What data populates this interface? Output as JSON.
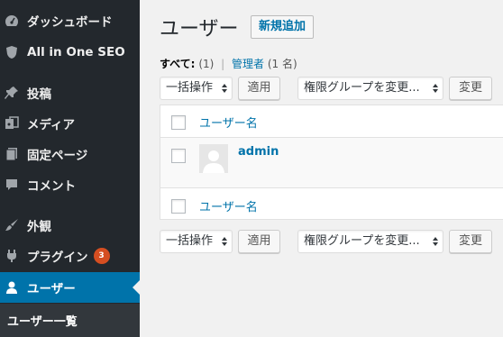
{
  "sidebar": {
    "items": [
      {
        "label": "ダッシュボード",
        "icon": "dashboard-icon"
      },
      {
        "label": "All in One SEO",
        "icon": "shield-icon"
      },
      {
        "label": "投稿",
        "icon": "pin-icon"
      },
      {
        "label": "メディア",
        "icon": "media-icon"
      },
      {
        "label": "固定ページ",
        "icon": "page-icon"
      },
      {
        "label": "コメント",
        "icon": "comment-icon"
      },
      {
        "label": "外観",
        "icon": "brush-icon"
      },
      {
        "label": "プラグイン",
        "icon": "plugin-icon",
        "badge": "3"
      },
      {
        "label": "ユーザー",
        "icon": "user-icon",
        "active": true
      }
    ],
    "submenu": {
      "label": "ユーザー一覧"
    },
    "colors": {
      "bg": "#23282d",
      "active": "#0073aa",
      "badge": "#d54e21"
    }
  },
  "header": {
    "title": "ユーザー",
    "add_new": "新規追加"
  },
  "filters": {
    "all_label": "すべて:",
    "all_count": "(1)",
    "separator": "|",
    "admin_label": "管理者",
    "admin_count": "(1 名)"
  },
  "bulk_top": {
    "action_select": "一括操作",
    "apply": "適用",
    "role_select": "権限グループを変更...",
    "change": "変更"
  },
  "table": {
    "header_col": "ユーザー名",
    "footer_col": "ユーザー名",
    "rows": [
      {
        "username": "admin"
      }
    ]
  },
  "bulk_bottom": {
    "action_select": "一括操作",
    "apply": "適用",
    "role_select": "権限グループを変更...",
    "change": "変更"
  }
}
